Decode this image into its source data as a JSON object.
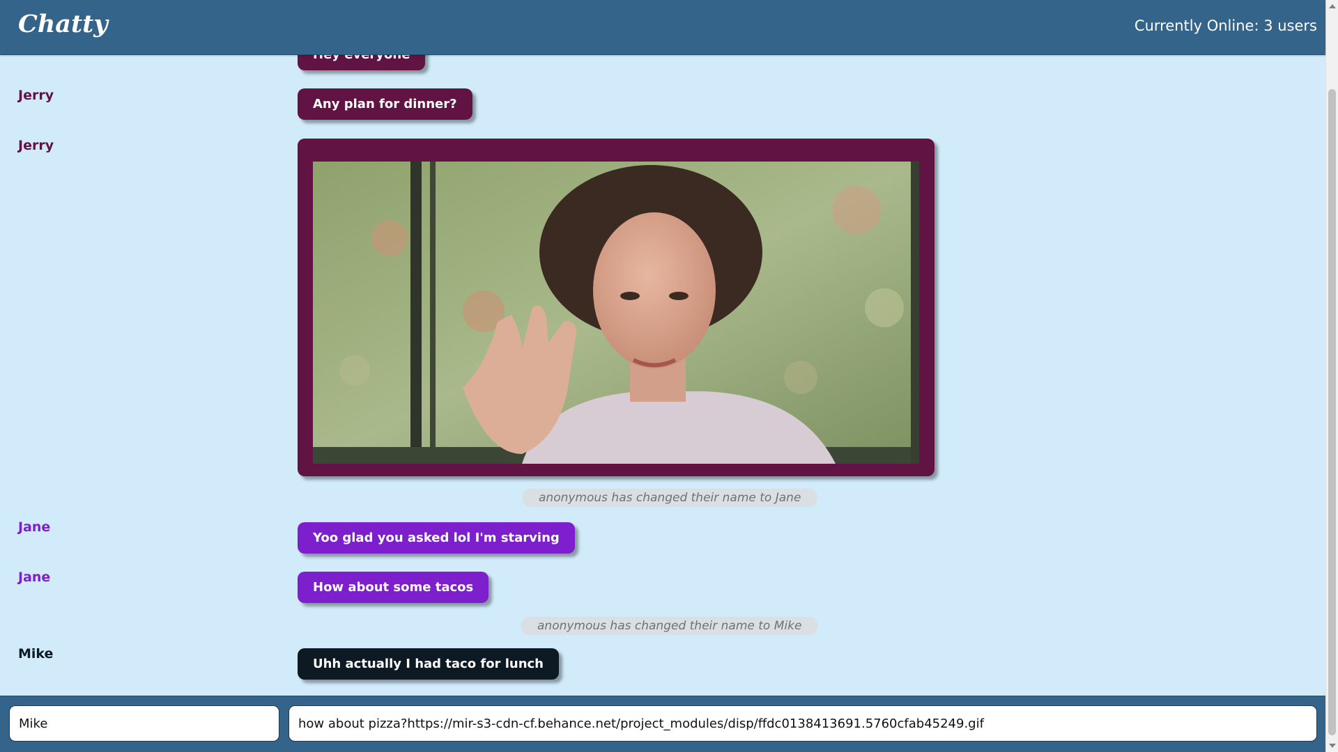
{
  "app": {
    "title": "Chatty",
    "online_text": "Currently Online: 3 users"
  },
  "messages": [
    {
      "user": "",
      "text": "Hey everyone",
      "color": "#611444"
    },
    {
      "user": "Jerry",
      "text": "Any plan for dinner?",
      "color": "#611444"
    },
    {
      "user": "Jerry",
      "type": "image",
      "color": "#611444"
    },
    {
      "notice": "anonymous has changed their name to Jane"
    },
    {
      "user": "Jane",
      "text": "Yoo glad you asked lol I'm starving",
      "color": "#7d1fcd"
    },
    {
      "user": "Jane",
      "text": "How about some tacos",
      "color": "#7d1fcd"
    },
    {
      "notice": "anonymous has changed their name to Mike"
    },
    {
      "user": "Mike",
      "text": "Uhh actually I had taco for lunch",
      "color": "#0d1a24"
    }
  ],
  "footer": {
    "name_value": "Mike",
    "message_value": "how about pizza?https://mir-s3-cdn-cf.behance.net/project_modules/disp/ffdc0138413691.5760cfab45249.gif"
  },
  "colors": {
    "header_bg": "#346489",
    "page_bg": "#d1ebfb",
    "jerry": "#611444",
    "jane": "#7d1fcd",
    "mike": "#0d1a24"
  }
}
